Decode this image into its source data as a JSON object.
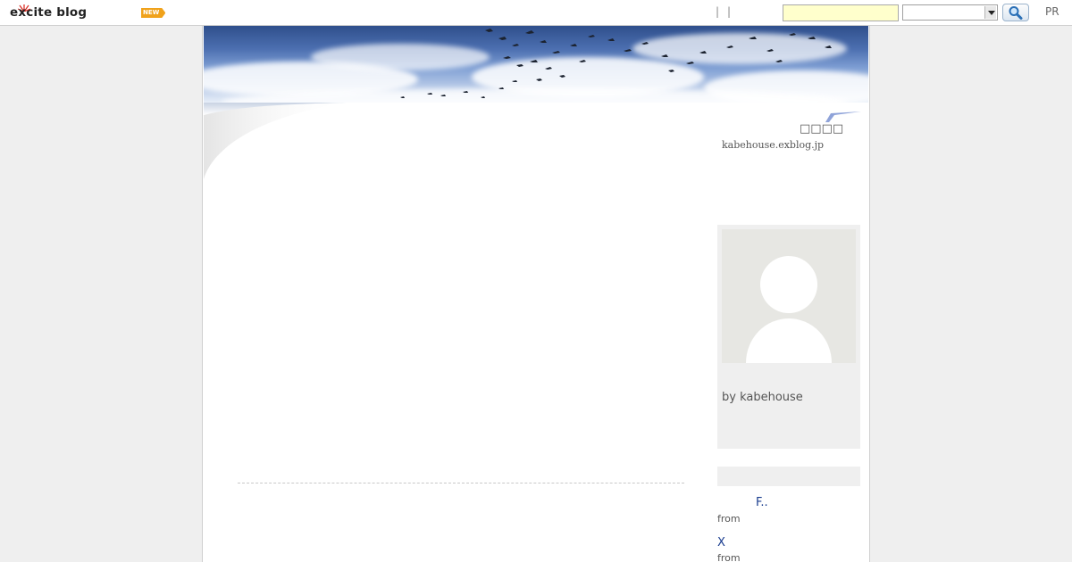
{
  "topbar": {
    "logo_prefix": "e",
    "logo_x": "x",
    "logo_rest": "cite blog",
    "new_badge": "NEW",
    "separator": "|",
    "search_placeholder": "",
    "search_category": "",
    "pr_label": "PR"
  },
  "header": {
    "blog_title": "□□□□",
    "blog_url": "kabehouse.exblog.jp"
  },
  "profile": {
    "by_line": "by kabehouse"
  },
  "recent_comments": [
    {
      "title": "F..",
      "from": "from"
    },
    {
      "title": "X",
      "from": "from"
    }
  ],
  "colors": {
    "accent": "#f0a21b",
    "link": "#1a3d8f",
    "search_field_bg": "#ffffcc"
  }
}
